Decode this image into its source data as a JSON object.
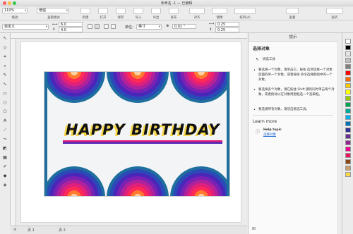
{
  "window": {
    "title": "未命名 -1 — 已编辑"
  },
  "toolbar": {
    "zoom_value": "110%",
    "view_mode_value": "增强",
    "labels": [
      "缩放",
      "查看模式",
      "新建",
      "打开",
      "保存",
      "导入",
      "导出",
      "发布",
      "撤消",
      "重做",
      "取消群组",
      "对齐",
      "镜像",
      "排列(A)",
      "查看",
      "贴齐"
    ],
    "right_label": "贴齐"
  },
  "propbar": {
    "preset_value": "自定义",
    "width_value": "6.0",
    "height_value": "4.0",
    "units_label": "单位:",
    "units_value": "英寸",
    "nudge_value": "0.01 \"",
    "dup_x": "0.25",
    "dup_y": "0.25"
  },
  "canvas": {
    "headline": "HAPPY  BIRTHDAY"
  },
  "page_tabs": {
    "page1": "页 1",
    "page2": "页 2"
  },
  "panel": {
    "header": "提示",
    "section_title": "选择对象",
    "tool_name": "挑选工具",
    "bullets": [
      "要选择一个对象，请单击它。按住 选项选择一个对象后面的另一个对象。或者按住 命令选择群组中的一个对象。",
      "要选择多个对象，请在按住 Shift 键的同时单击每个对象，或者拖动以在对象周围框选一个选取框。",
      "要选择所有对象，请双击挑选工具。"
    ],
    "learn_more": "Learn more",
    "help_title": "Help topic",
    "help_link": "选择对象"
  },
  "palette": {
    "colors": [
      "#ffffff",
      "#000000",
      "#e6e6e6",
      "#c0c0c0",
      "#808080",
      "#ff0000",
      "#ff6a00",
      "#ffcc00",
      "#ffff00",
      "#99cc00",
      "#00a651",
      "#00a99d",
      "#00aeef",
      "#0072bc",
      "#2e3192",
      "#662d91",
      "#92278f",
      "#ec008c",
      "#ed145b",
      "#8b4513",
      "#c69c6d",
      "#f7d84a"
    ]
  }
}
